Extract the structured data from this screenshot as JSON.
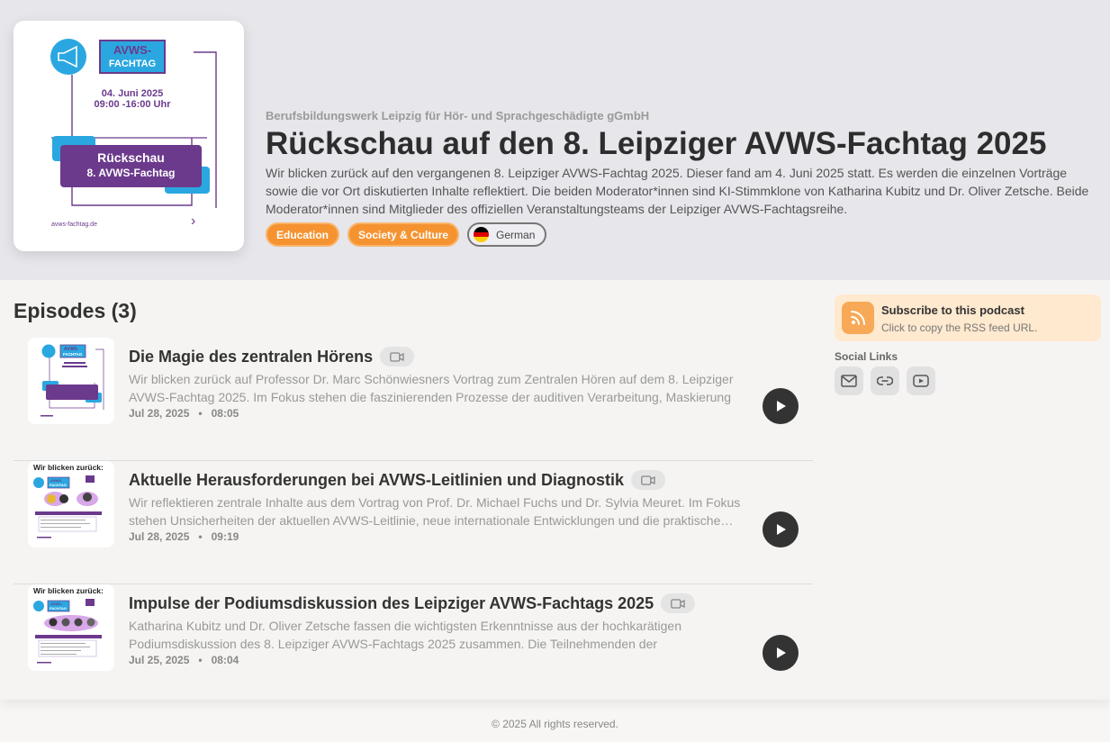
{
  "podcast": {
    "author": "Berufsbildungswerk Leipzig für Hör- und Sprachgeschädigte gGmbH",
    "title": "Rückschau auf den 8. Leipziger AVWS-Fachtag 2025",
    "description": "Wir blicken zurück auf den vergangenen 8. Leipziger AVWS-Fachtag 2025. Dieser fand am 4. Juni 2025 statt. Es werden die einzelnen Vorträge sowie die vor Ort diskutierten Inhalte reflektiert. Die beiden Moderator*innen sind KI-Stimmklone von Katharina Kubitz und Dr. Oliver Zetsche. Beide Moderator*innen sind Mitglieder des offiziellen Veranstaltungsteams der Leipziger AVWS-Fachtagsreihe.",
    "tags": [
      "Education",
      "Society & Culture"
    ],
    "language": "German"
  },
  "cover": {
    "badge_line1": "AVWS-",
    "badge_line2": "FACHTAG",
    "date": "04. Juni 2025",
    "time": "09:00 -16:00 Uhr",
    "box_line1": "Rückschau",
    "box_line2": "8. AVWS-Fachtag",
    "url": "avws-fachtag.de"
  },
  "thumb_text": {
    "heading": "Wir blicken zurück:",
    "badge_line1": "AVWS-",
    "badge_line2": "FACHTAG"
  },
  "episodes_heading": "Episodes (3)",
  "episodes": [
    {
      "title": "Die Magie des zentralen Hörens",
      "description": "Wir blicken zurück auf Professor Dr. Marc Schönwiesners Vortrag zum Zentralen Hören auf dem 8. Leipziger AVWS-Fachtag 2025. Im Fokus stehen die faszinierenden Prozesse der auditiven Verarbeitung, Maskierung und…",
      "date": "Jul 28, 2025",
      "duration": "08:05"
    },
    {
      "title": "Aktuelle Herausforderungen bei AVWS-Leitlinien und Diagnostik",
      "description": "Wir reflektieren zentrale Inhalte aus dem Vortrag von Prof. Dr. Michael Fuchs und Dr. Sylvia Meuret. Im Fokus stehen Unsicherheiten der aktuellen AVWS-Leitlinie, neue internationale Entwicklungen und die praktische…",
      "date": "Jul 28, 2025",
      "duration": "09:19"
    },
    {
      "title": "Impulse der Podiumsdiskussion des Leipziger AVWS-Fachtags 2025",
      "description": "Katharina Kubitz und Dr. Oliver Zetsche fassen die wichtigsten Erkenntnisse aus der hochkarätigen Podiumsdiskussion des 8. Leipziger AVWS-Fachtags 2025 zusammen. Die Teilnehmenden der Podiumsdiskussion…",
      "date": "Jul 25, 2025",
      "duration": "08:04"
    }
  ],
  "meta_separator": "•",
  "subscribe": {
    "title": "Subscribe to this podcast",
    "hint": "Click to copy the RSS feed URL."
  },
  "social_label": "Social Links",
  "social_icons": [
    "mail-icon",
    "link-icon",
    "youtube-icon"
  ],
  "footer": "© 2025 All rights reserved.",
  "colors": {
    "accent": "#f59331",
    "purple": "#6b3a8c",
    "blue": "#2aa7e0",
    "header_bg": "#e6e6eb",
    "subscribe_bg": "#ffe9cf"
  }
}
